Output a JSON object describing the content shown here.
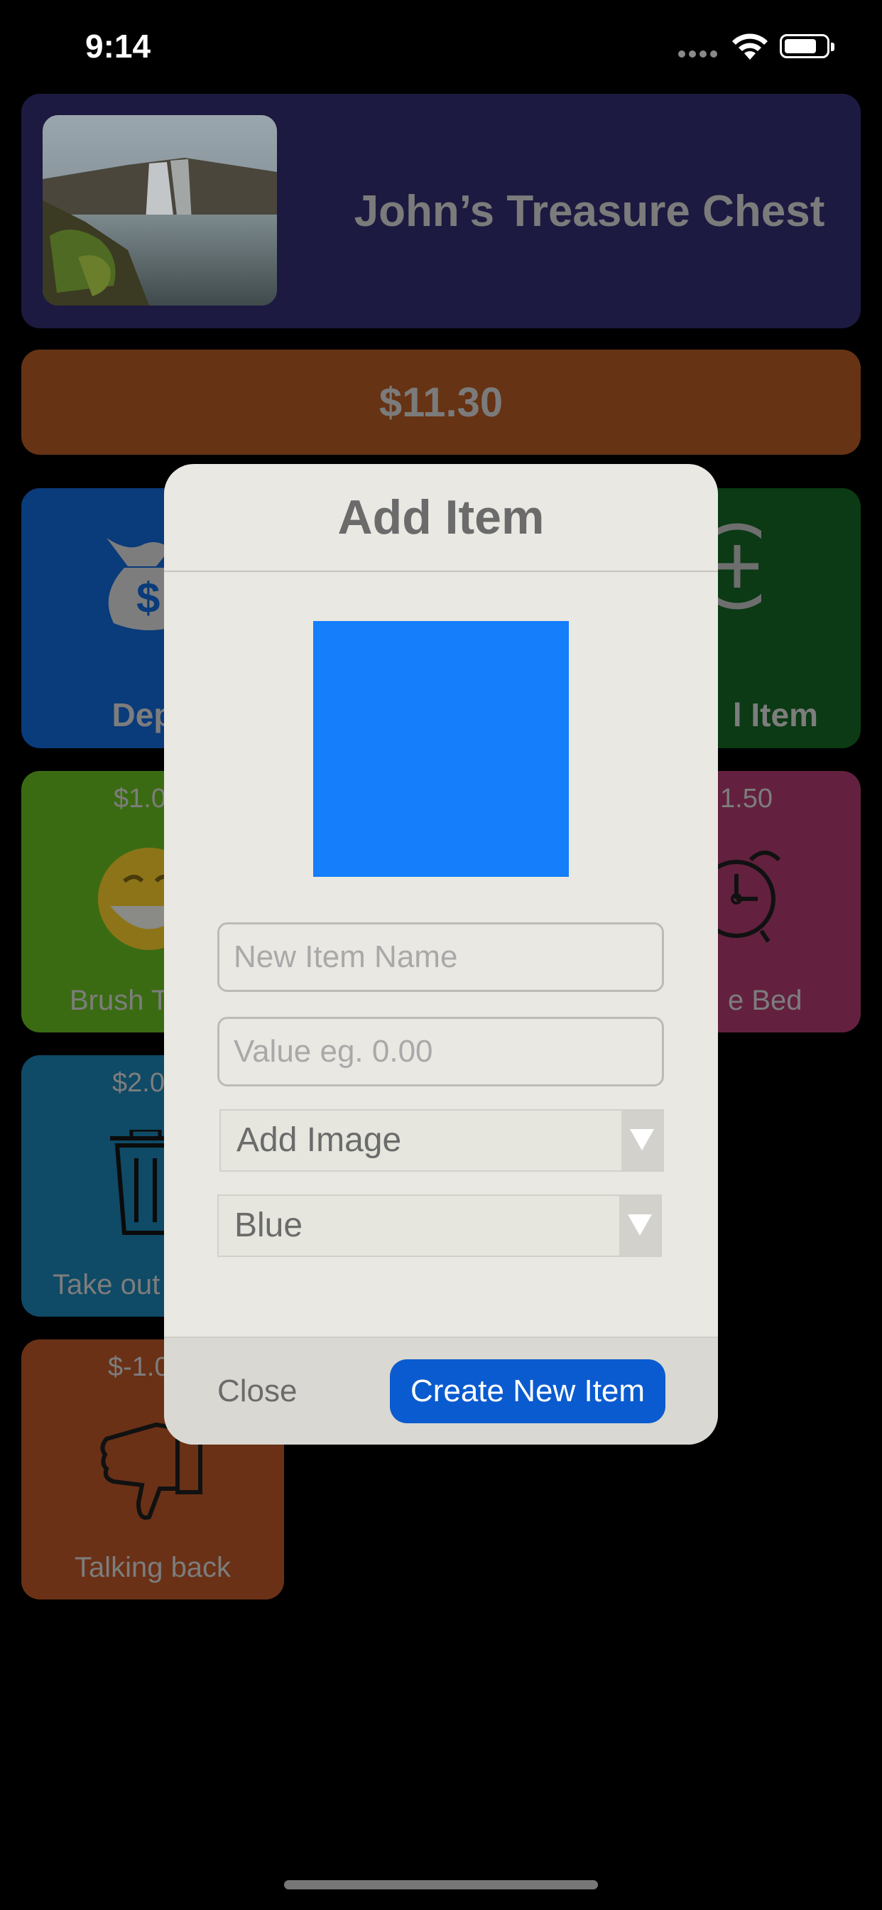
{
  "status_bar": {
    "time": "9:14"
  },
  "header": {
    "title": "John’s Treasure Chest"
  },
  "balance": {
    "amount": "$11.30"
  },
  "tiles": {
    "deposit": {
      "label": "Depo"
    },
    "add_item": {
      "label": "l Item"
    },
    "brush_teeth": {
      "price": "$1.0",
      "label": "Brush T"
    },
    "make_bed": {
      "price": "1.50",
      "label": "e Bed"
    },
    "trash": {
      "price": "$2.0",
      "label": "Take out"
    },
    "talking_back": {
      "price": "$-1.0",
      "label": "Talking back"
    }
  },
  "modal": {
    "title": "Add Item",
    "preview_color": "#147efb",
    "name_field": {
      "placeholder": "New Item Name",
      "value": ""
    },
    "value_field": {
      "placeholder": "Value eg. 0.00",
      "value": ""
    },
    "image_select": {
      "selected": "Add Image"
    },
    "color_select": {
      "selected": "Blue"
    },
    "close_label": "Close",
    "create_label": "Create New Item"
  },
  "colors": {
    "header_bg": "#1c1a40",
    "balance_bg": "#663314",
    "deposit_bg": "#0a3b7a",
    "add_bg": "#0b3a14",
    "brush_bg": "#3a6b12",
    "bed_bg": "#63213f",
    "trash_bg": "#0f4a66",
    "talking_bg": "#6a3116",
    "create_button": "#0a5bcf"
  }
}
